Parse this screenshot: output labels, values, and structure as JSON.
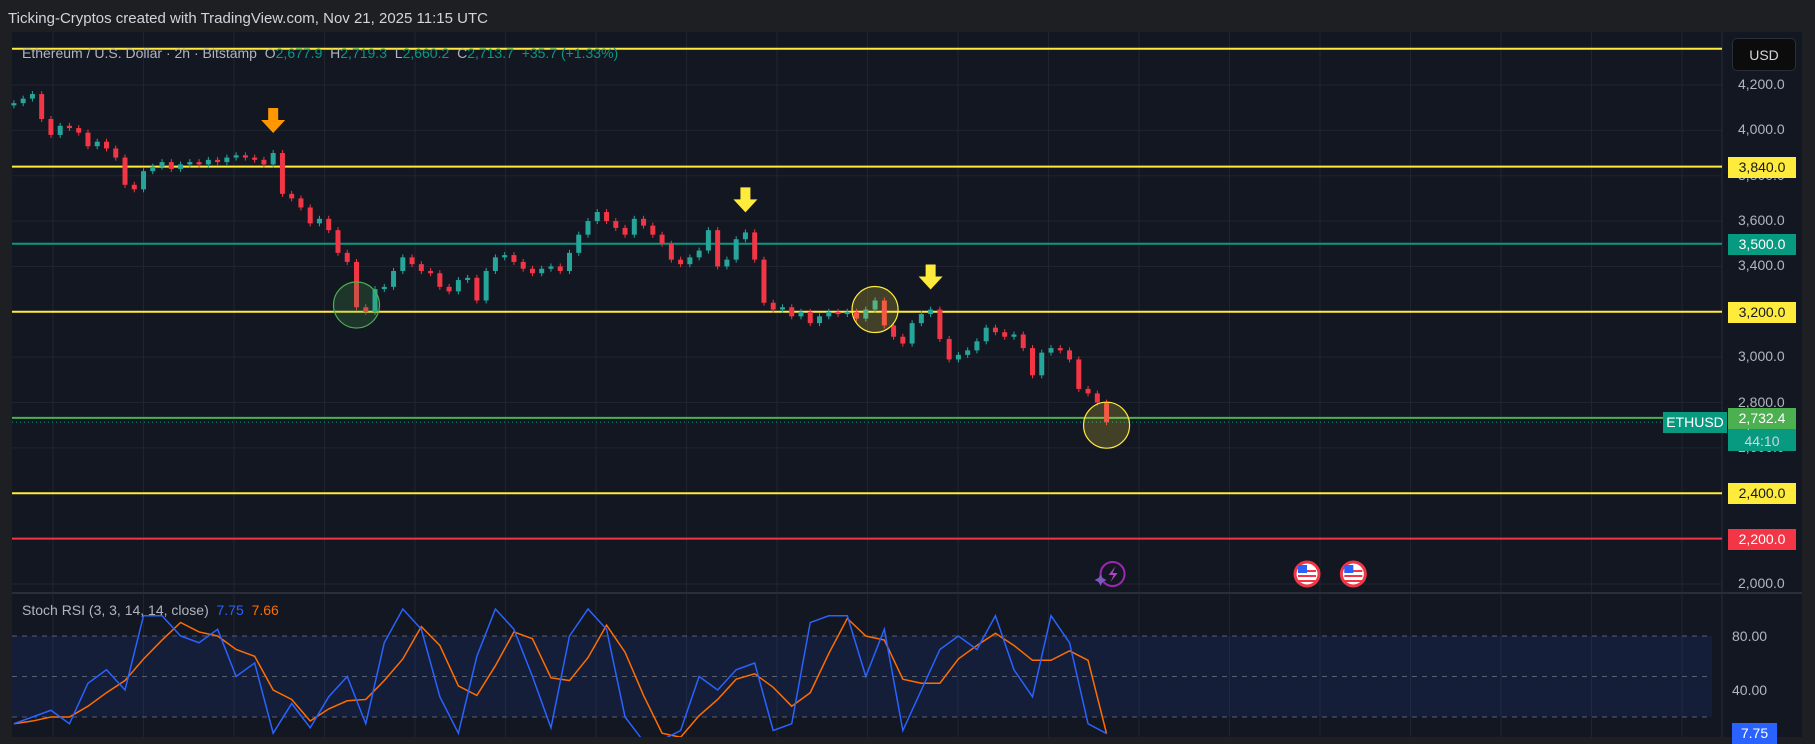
{
  "header": {
    "title": "Ticking-Cryptos created with TradingView.com, Nov 21, 2025 11:15 UTC"
  },
  "legend": {
    "symbol": "Ethereum / U.S. Dollar · 2h · Bitstamp",
    "o_label": "O",
    "o": "2,677.9",
    "h_label": "H",
    "h": "2,719.3",
    "l_label": "L",
    "l": "2,660.2",
    "c_label": "C",
    "c": "2,713.7",
    "change": "+35.7 (+1.33%)"
  },
  "currency_button": "USD",
  "symbol_tag": "ETHUSD",
  "last_price": "2,713.7",
  "countdown": "44:10",
  "stoch": {
    "label": "Stoch RSI (3, 3, 14, 14, close)",
    "k_value": "7.75",
    "d_value": "7.66",
    "axis_labels": [
      "80.00",
      "40.00"
    ],
    "k_tag": "7.75"
  },
  "colors": {
    "background": "#131722",
    "up": "#26a69a",
    "down": "#f23645",
    "k_line": "#2962ff",
    "d_line": "#ff6d00",
    "yellow": "#ffeb3b",
    "teal": "#089981",
    "red": "#f23645",
    "green": "#4caf50"
  },
  "chart_data": {
    "type": "candlestick",
    "ylim": [
      2000,
      4200
    ],
    "y_ticks": [
      "4,200.0",
      "4,000.0",
      "3,800.0",
      "3,600.0",
      "3,400.0",
      "3,200.0",
      "3,000.0",
      "2,800.0",
      "2,600.0",
      "2,400.0",
      "2,200.0",
      "2,000.0"
    ],
    "grid": true,
    "first_open": 4110,
    "closes": [
      4120,
      4140,
      4160,
      4050,
      3980,
      4020,
      4010,
      3990,
      3930,
      3950,
      3920,
      3880,
      3760,
      3740,
      3820,
      3840,
      3860,
      3830,
      3850,
      3860,
      3850,
      3870,
      3860,
      3880,
      3890,
      3880,
      3870,
      3850,
      3900,
      3720,
      3700,
      3660,
      3590,
      3610,
      3560,
      3460,
      3420,
      3220,
      3200,
      3300,
      3310,
      3380,
      3440,
      3410,
      3380,
      3370,
      3310,
      3290,
      3340,
      3350,
      3250,
      3380,
      3440,
      3450,
      3420,
      3390,
      3370,
      3390,
      3400,
      3380,
      3460,
      3540,
      3600,
      3640,
      3600,
      3570,
      3540,
      3610,
      3580,
      3540,
      3500,
      3430,
      3410,
      3440,
      3470,
      3560,
      3400,
      3430,
      3520,
      3550,
      3430,
      3240,
      3210,
      3220,
      3180,
      3200,
      3150,
      3180,
      3200,
      3190,
      3200,
      3170,
      3210,
      3250,
      3140,
      3090,
      3060,
      3150,
      3190,
      3210,
      3080,
      2990,
      3010,
      3030,
      3070,
      3130,
      3110,
      3090,
      3100,
      3040,
      2920,
      3020,
      3040,
      3030,
      2990,
      2860,
      2840,
      2800,
      2713.7
    ],
    "levels": [
      {
        "price": 4360,
        "color": "#ffeb3b",
        "label": ""
      },
      {
        "price": 3840,
        "color": "#ffeb3b",
        "label": "3,840.0"
      },
      {
        "price": 3500,
        "color": "#089981",
        "label": "3,500.0"
      },
      {
        "price": 3200,
        "color": "#ffeb3b",
        "label": "3,200.0"
      },
      {
        "price": 2732.4,
        "color": "#4caf50",
        "label": "2,732.4"
      },
      {
        "price": 2400,
        "color": "#ffeb3b",
        "label": "2,400.0"
      },
      {
        "price": 2200,
        "color": "#f23645",
        "label": "2,200.0"
      }
    ],
    "arrows": [
      {
        "candle": 28,
        "color": "#ff9800"
      },
      {
        "candle": 79,
        "color": "#ffeb3b"
      },
      {
        "candle": 99,
        "color": "#ffeb3b"
      }
    ],
    "circles": [
      {
        "candle": 37,
        "price": 3230,
        "color": "#4caf50"
      },
      {
        "candle": 93,
        "price": 3210,
        "color": "#ffeb3b"
      },
      {
        "candle": 118,
        "price": 2700,
        "color": "#ffeb3b"
      }
    ],
    "events": [
      {
        "type": "lightning-icon",
        "candle": 118
      },
      {
        "type": "us-flag-icon",
        "candle": 139
      },
      {
        "type": "us-flag-icon",
        "candle": 144
      }
    ],
    "stoch_rsi": {
      "ylim": [
        0,
        100
      ],
      "bands": [
        80,
        50,
        20
      ],
      "k": [
        15,
        20,
        25,
        15,
        45,
        55,
        40,
        95,
        95,
        80,
        75,
        85,
        50,
        60,
        8,
        30,
        12,
        35,
        50,
        15,
        75,
        100,
        85,
        35,
        8,
        65,
        100,
        85,
        50,
        12,
        80,
        100,
        85,
        20,
        2,
        3,
        10,
        50,
        40,
        55,
        60,
        10,
        15,
        90,
        95,
        95,
        50,
        85,
        10,
        40,
        70,
        80,
        70,
        95,
        55,
        35,
        95,
        75,
        15,
        7.75
      ],
      "d": [
        15,
        17,
        20,
        20,
        28,
        38,
        47,
        63,
        77,
        90,
        83,
        80,
        70,
        65,
        40,
        33,
        17,
        26,
        32,
        33,
        47,
        63,
        87,
        73,
        43,
        36,
        58,
        83,
        78,
        49,
        47,
        64,
        88,
        68,
        36,
        8,
        5,
        21,
        33,
        48,
        52,
        42,
        28,
        38,
        67,
        93,
        80,
        77,
        48,
        45,
        45,
        63,
        73,
        82,
        73,
        62,
        62,
        69,
        62,
        7.66
      ]
    }
  }
}
